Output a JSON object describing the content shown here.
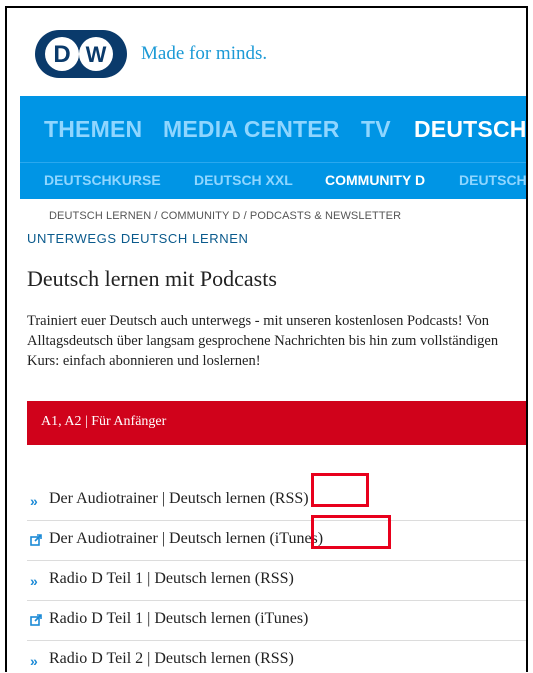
{
  "brand": {
    "logo_text": "DW",
    "tagline": "Made for minds."
  },
  "main_nav": [
    "THEMEN",
    "MEDIA CENTER",
    "TV",
    "DEUTSCH"
  ],
  "main_nav_active": "DEUTSCH",
  "sub_nav": [
    "DEUTSCHKURSE",
    "DEUTSCH XXL",
    "COMMUNITY D",
    "DEUTSCH"
  ],
  "sub_nav_active": "COMMUNITY D",
  "breadcrumb": "DEUTSCH LERNEN / COMMUNITY D / PODCASTS & NEWSLETTER",
  "kicker": "UNTERWEGS DEUTSCH LERNEN",
  "title": "Deutsch lernen mit Podcasts",
  "intro": "Trainiert euer Deutsch auch unterwegs - mit unseren kostenlosen Podcasts! Von Alltagsdeutsch über langsam gesprochene Nachrichten bis hin zum vollständigen Kurs: einfach abonnieren und loslernen!",
  "section_header": "A1, A2 | Für Anfänger",
  "podcasts": [
    {
      "icon": "double-chevron-icon",
      "label": "Der Audiotrainer | Deutsch lernen (RSS)"
    },
    {
      "icon": "external-link-icon",
      "label": "Der Audiotrainer | Deutsch lernen (iTunes)"
    },
    {
      "icon": "double-chevron-icon",
      "label": "Radio D Teil 1 | Deutsch lernen (RSS)"
    },
    {
      "icon": "external-link-icon",
      "label": "Radio D Teil 1 | Deutsch lernen (iTunes)"
    },
    {
      "icon": "double-chevron-icon",
      "label": "Radio D Teil 2 | Deutsch lernen (RSS)"
    }
  ],
  "colors": {
    "nav_blue": "#0095e5",
    "nav_inactive": "#8fd6ff",
    "logo_navy": "#0a3a6b",
    "accent_red": "#d0021b",
    "highlight_red": "#e8001c",
    "link_blue": "#1c8ad6"
  }
}
